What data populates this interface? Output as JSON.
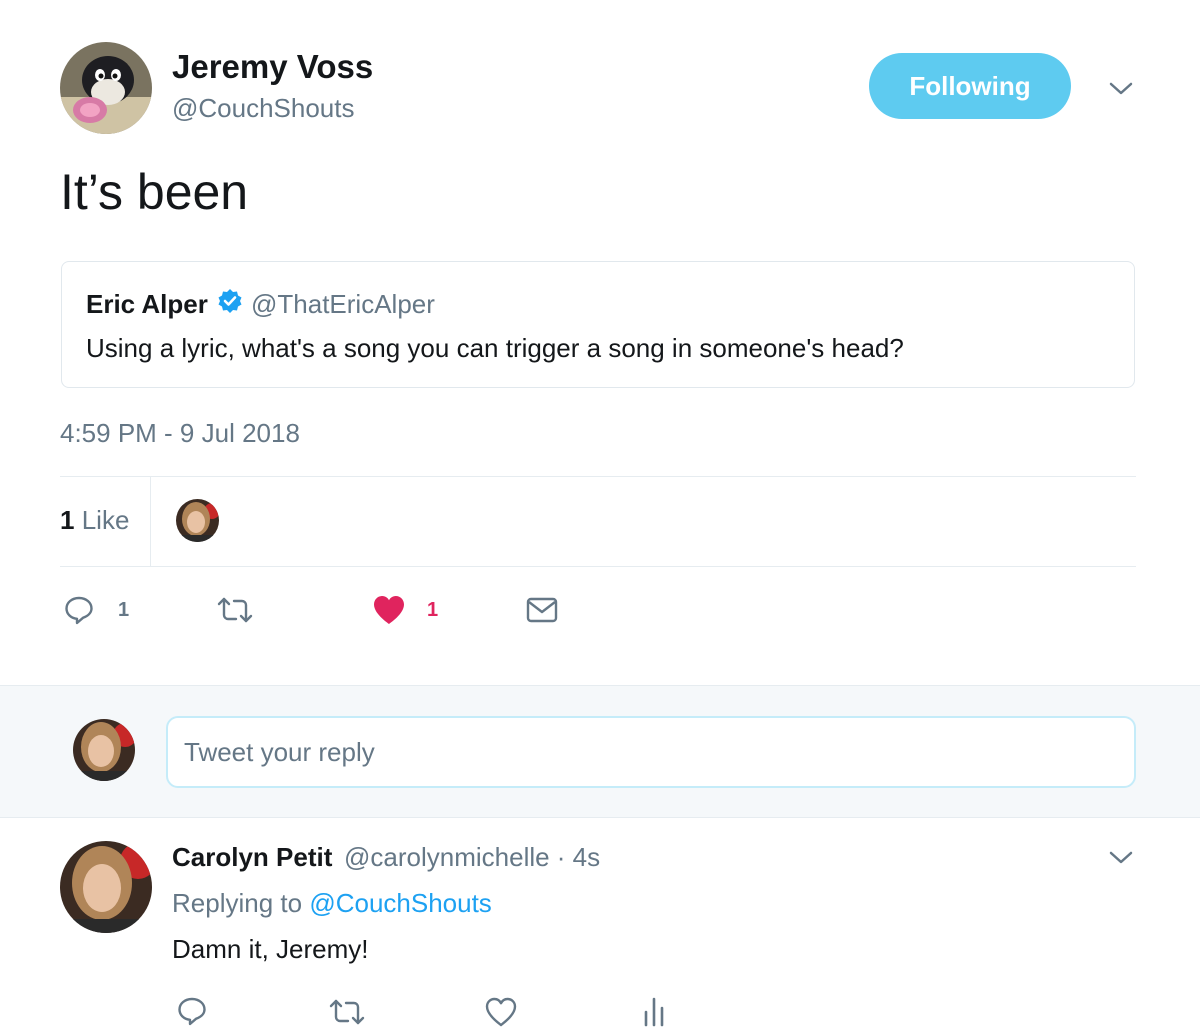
{
  "tweet": {
    "author_name": "Jeremy Voss",
    "author_handle": "@CouchShouts",
    "follow_button_label": "Following",
    "text": "It’s been",
    "quoted": {
      "author_name": "Eric Alper",
      "author_handle": "@ThatEricAlper",
      "verified": true,
      "text": "Using a lyric, what's a song you can trigger a song in someone's head?"
    },
    "timestamp": "4:59 PM - 9 Jul 2018",
    "likes_count": "1",
    "likes_label": "Like",
    "actions": {
      "reply_count": "1",
      "like_count": "1"
    }
  },
  "reply_box": {
    "placeholder": "Tweet your reply"
  },
  "reply": {
    "author_name": "Carolyn Petit",
    "author_handle_time": "@carolynmichelle · 4s",
    "replying_prefix": "Replying to",
    "replying_mention": "@CouchShouts",
    "text": "Damn it, Jeremy!"
  },
  "colors": {
    "follow_button": "#5ecbf0",
    "like_heart": "#e0245e",
    "link": "#1da1f2",
    "verified_badge": "#1da1f2",
    "secondary_text": "#657786"
  }
}
